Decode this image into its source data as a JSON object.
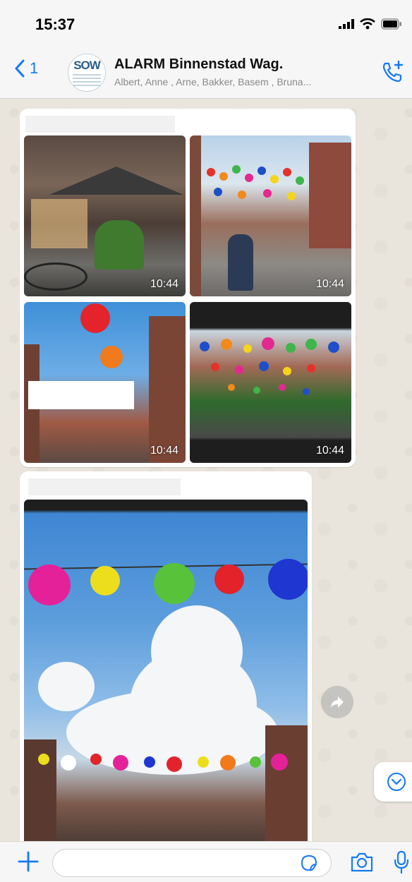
{
  "status_bar": {
    "time": "15:37"
  },
  "header": {
    "back_count": "1",
    "avatar_text": "SOW",
    "title": "ALARM Binnenstad Wag.",
    "subtitle": "Albert, Anne , Arne, Bakker, Basem , Bruna..."
  },
  "messages": {
    "album": {
      "photos": [
        {
          "timestamp": "10:44"
        },
        {
          "timestamp": "10:44"
        },
        {
          "timestamp": "10:44"
        },
        {
          "timestamp": "10:44"
        }
      ]
    }
  },
  "input": {
    "placeholder": ""
  },
  "colors": {
    "accent": "#1479f5",
    "chat_background": "#efeae2",
    "bubble": "#ffffff"
  },
  "icons": [
    "back-chevron-icon",
    "add-call-icon",
    "forward-icon",
    "chevron-down-icon",
    "plus-icon",
    "sticker-icon",
    "camera-icon",
    "microphone-icon",
    "signal-icon",
    "wifi-icon",
    "battery-icon"
  ]
}
